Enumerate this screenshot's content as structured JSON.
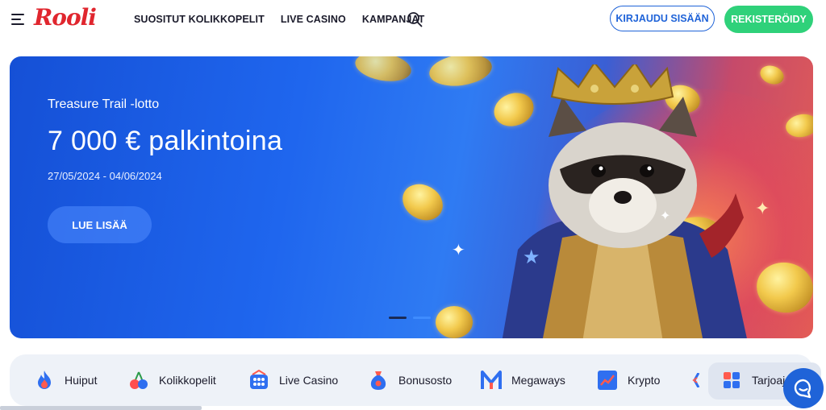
{
  "header": {
    "logo": "Rooli",
    "nav": [
      "SUOSITUT KOLIKKOPELIT",
      "LIVE CASINO",
      "KAMPANJAT"
    ],
    "login_label": "KIRJAUDU SISÄÄN",
    "register_label": "REKISTERÖIDY"
  },
  "hero": {
    "subtitle": "Treasure Trail -lotto",
    "title": "7 000 € palkintoina",
    "dates": "27/05/2024 - 04/06/2024",
    "cta_label": "LUE LISÄÄ",
    "slide_count": 2,
    "active_slide": 1
  },
  "categories": [
    {
      "label": "Huiput",
      "icon": "fire-icon"
    },
    {
      "label": "Kolikkopelit",
      "icon": "cherries-icon"
    },
    {
      "label": "Live Casino",
      "icon": "casino-table-icon"
    },
    {
      "label": "Bonusosto",
      "icon": "money-bag-icon"
    },
    {
      "label": "Megaways",
      "icon": "megaways-icon"
    },
    {
      "label": "Krypto",
      "icon": "chart-icon"
    },
    {
      "label": "Tarjoaja",
      "icon": "providers-icon"
    }
  ],
  "colors": {
    "brand_red": "#e0262e",
    "primary_blue": "#1f63d8",
    "register_green": "#2fd17a"
  }
}
